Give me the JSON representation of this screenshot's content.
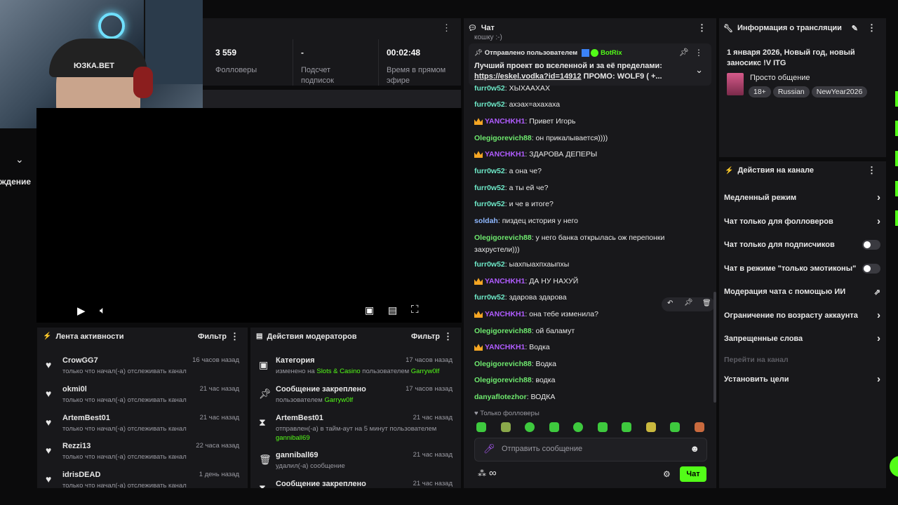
{
  "stats": [
    {
      "value": "3 559",
      "label": "Фолловеры"
    },
    {
      "value": "-",
      "label": "Подсчет подписок"
    },
    {
      "value": "00:02:48",
      "label": "Время в прямом эфире"
    }
  ],
  "left_edge_text": "ждение",
  "webcam_cap_text": "ЮЗКА.BET",
  "activity": {
    "title": "Лента активности",
    "filter": "Фильтр",
    "items": [
      {
        "name": "CrowGG7",
        "time": "16 часов назад",
        "desc": "только что начал(-а) отслеживать канал"
      },
      {
        "name": "okmi0l",
        "time": "21 час назад",
        "desc": "только что начал(-а) отслеживать канал"
      },
      {
        "name": "ArtemBest01",
        "time": "21 час назад",
        "desc": "только что начал(-а) отслеживать канал"
      },
      {
        "name": "Rezzi13",
        "time": "22 часа назад",
        "desc": "только что начал(-а) отслеживать канал"
      },
      {
        "name": "idrisDEAD",
        "time": "1 день назад",
        "desc": "только что начал(-а) отслеживать канал"
      }
    ]
  },
  "mod": {
    "title": "Действия модераторов",
    "filter": "Фильтр",
    "items": [
      {
        "name": "Категория",
        "time": "17 часов назад",
        "d1": "изменено на ",
        "d2": "Slots & Casino",
        "d3": " пользователем ",
        "d4": "Garryw0lf"
      },
      {
        "name": "Сообщение закреплено",
        "time": "17 часов назад",
        "d1": "пользователем ",
        "d2": "Garryw0lf"
      },
      {
        "name": "ArtemBest01",
        "time": "21 час назад",
        "d1": "отправлен(-а) в тайм-аут на 5 минут пользователем ",
        "d2": "ganniball69"
      },
      {
        "name": "ganniball69",
        "time": "21 час назад",
        "d1": "удалил(-а) сообщение"
      },
      {
        "name": "Сообщение закреплено",
        "time": "21 час назад"
      }
    ]
  },
  "chat": {
    "title": "Чат",
    "top_partial": "кошку :-)",
    "pinned": {
      "sent_by": "Отправлено пользователем",
      "user": "BotRix",
      "text": "Лучший проект во вселенной и за её пределами:",
      "link": "https://eskel.vodka?id=14912",
      "rest": " ПРОМО: WOLF9 ( +..."
    },
    "messages": [
      {
        "user": "furr0w52",
        "text": "ХЫХААХАХ",
        "color": "cyan"
      },
      {
        "user": "furr0w52",
        "text": "ахэах=ахахаха",
        "color": "cyan"
      },
      {
        "user": "YANCHKH1",
        "text": "Привет Игорь",
        "color": "purple",
        "crown": true
      },
      {
        "user": "Olegigorevich88",
        "text": "он прикалывается))))",
        "color": "green"
      },
      {
        "user": "YANCHKH1",
        "text": "ЗДАРОВА ДЕПЕРЫ",
        "color": "purple",
        "crown": true
      },
      {
        "user": "furr0w52",
        "text": "а она че?",
        "color": "cyan"
      },
      {
        "user": "furr0w52",
        "text": "а ты ей че?",
        "color": "cyan"
      },
      {
        "user": "furr0w52",
        "text": "и че в итоге?",
        "color": "cyan"
      },
      {
        "user": "soldah",
        "text": "пиздец история у него",
        "color": "blue"
      },
      {
        "user": "Olegigorevich88",
        "text": "у него банка открылась ож перепонки захрустели)))",
        "color": "green"
      },
      {
        "user": "furr0w52",
        "text": "ыахпыахпхаыпхы",
        "color": "cyan"
      },
      {
        "user": "YANCHKH1",
        "text": "ДА НУ НАХУЙ",
        "color": "purple",
        "crown": true
      },
      {
        "user": "furr0w52",
        "text": "здарова здарова",
        "color": "cyan"
      },
      {
        "user": "YANCHKH1",
        "text": "она тебе изменила?",
        "color": "purple",
        "crown": true
      },
      {
        "user": "Olegigorevich88",
        "text": "ой баламут",
        "color": "green"
      },
      {
        "user": "YANCHKH1",
        "text": "Водка",
        "color": "purple",
        "crown": true
      },
      {
        "user": "Olegigorevich88",
        "text": "Водка",
        "color": "green"
      },
      {
        "user": "Olegigorevich88",
        "text": "водка",
        "color": "green"
      },
      {
        "user": "danyaflotezhor",
        "text": "ВОДКА",
        "color": "green"
      }
    ],
    "followers_only": "Только фолловеры",
    "input_placeholder": "Отправить сообщение",
    "send_label": "Чат"
  },
  "info": {
    "title": "Информация о трансляции",
    "stream_title": "1 января 2026, Новый год, новый заносикс !V ITG",
    "category": "Просто общение",
    "tags": [
      "18+",
      "Russian",
      "NewYear2026"
    ]
  },
  "actions": {
    "title": "Действия на канале",
    "items": [
      {
        "label": "Медленный режим",
        "kind": "chevron"
      },
      {
        "label": "Чат только для фолловеров",
        "kind": "chevron"
      },
      {
        "label": "Чат только для подписчиков",
        "kind": "toggle"
      },
      {
        "label": "Чат в режиме \"только эмотиконы\"",
        "kind": "toggle"
      },
      {
        "label": "Модерация чата с помощью ИИ",
        "kind": "external"
      },
      {
        "label": "Ограничение по возрасту аккаунта",
        "kind": "chevron"
      },
      {
        "label": "Запрещенные слова",
        "kind": "chevron"
      },
      {
        "label": "Перейти на канал",
        "kind": "disabled"
      },
      {
        "label": "Установить цели",
        "kind": "chevron"
      }
    ]
  },
  "colors": {
    "accent": "#53fc18",
    "panel": "#18181b",
    "background": "#0b0b0c"
  }
}
